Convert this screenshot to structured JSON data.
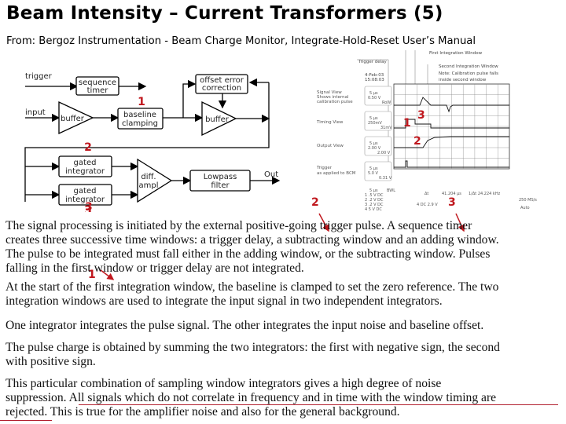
{
  "slide": {
    "title": "Beam Intensity – Current Transformers (5)",
    "subtitle": "From: Bergoz Instrumentation - Beam Charge Monitor, Integrate-Hold-Reset User’s Manual"
  },
  "block_diagram": {
    "inputs": {
      "trigger": "trigger",
      "input": "input"
    },
    "blocks": {
      "sequence_timer": [
        "sequence",
        "timer"
      ],
      "buffer_in": "buffer",
      "baseline_clamping": [
        "baseline",
        "clamping"
      ],
      "offset_correction": [
        "offset error",
        "correction"
      ],
      "buffer_out": "buffer",
      "gated_integrator_1": [
        "gated",
        "integrator"
      ],
      "gated_integrator_2": [
        "gated",
        "integrator"
      ],
      "diff_ampl": [
        "diff.",
        "ampl"
      ],
      "lowpass_filter": [
        "Lowpass",
        "filter"
      ]
    },
    "output_label": "Out",
    "markers": {
      "m1": "1",
      "m2": "2",
      "m3": "3"
    }
  },
  "scope": {
    "header_labels": {
      "trigger_delay": "Trigger delay",
      "first_window": "First Integration Window",
      "second_window": "Second Integration Window",
      "note_1": "Note:  Calibration pulse falls",
      "note_2": "inside second window",
      "date": "4-Feb-03",
      "time": "15:08:03"
    },
    "channels": [
      {
        "name_1": "Signal View",
        "name_2": "Shows internal",
        "name_3": "calibration pulse",
        "num": "1",
        "timebase": "5 µs",
        "scale": "0.50 V",
        "extra": "RoW"
      },
      {
        "name_1": "Timing View",
        "name_2": "",
        "name_3": "",
        "num": "2",
        "timebase": "5 µs",
        "scale": "250mV",
        "extra": "31mV"
      },
      {
        "name_1": "Output View",
        "name_2": "",
        "name_3": "",
        "num": "3",
        "timebase": "5 µs",
        "scale": "2.00 V",
        "extra": "2.00 V"
      },
      {
        "name_1": "Trigger",
        "name_2": "as applied to BCM",
        "name_3": "",
        "num": "4",
        "timebase": "5 µs",
        "scale": "5.0 V",
        "extra": "0.31 V"
      }
    ],
    "footer": {
      "timebase": "5 µs",
      "bwl": "BWL",
      "rows": [
        "1  .5  V  DC",
        "2  .2  V  DC",
        "3  .2  V  DC",
        "4   5  V  DC"
      ],
      "delta_t": "Δt",
      "delta_value": "41.204 µs",
      "freq": "1/Δt  24.224 kHz",
      "trig_level": "4  DC 2.9 V",
      "sample_rate": "250 MS/s",
      "mode": "Auto"
    },
    "markers": {
      "m1": "1",
      "m2": "2",
      "m3": "3"
    }
  },
  "annotations": {
    "m2_below_diagram": "2",
    "m3_below_diagram": "3",
    "m2_text": "2",
    "m3_text": "3",
    "m1_text": "1"
  },
  "paragraphs": {
    "p1": [
      "The signal processing is initiated by the external positive-going trigger pulse.  A sequence timer",
      "creates three successive time windows: a trigger delay, a subtracting window and an adding  window.",
      "The pulse to be integrated must fall either in the adding window, or the subtracting window.  Pulses",
      "falling in the first window or trigger delay are not integrated."
    ],
    "p2": [
      "At the start of the first integration window, the baseline is clamped to set the zero reference.   The two",
      "integration windows are used to integrate the input signal in two independent integrators."
    ],
    "p3": [
      "One integrator integrates the pulse signal.  The other integrates the input noise and baseline offset."
    ],
    "p4": [
      "The pulse charge is obtained by summing the two integrators:  the first with negative sign, the second",
      "with positive sign."
    ],
    "p5": [
      "This particular combination of sampling window integrators gives a high degree of noise",
      "suppression.  All signals which do not correlate in frequency and in time with the window timing are",
      "rejected. This is true for the amplifier noise and also for the general background."
    ]
  },
  "colors": {
    "accent_red": "#c0181e",
    "underline": "#b22030"
  }
}
